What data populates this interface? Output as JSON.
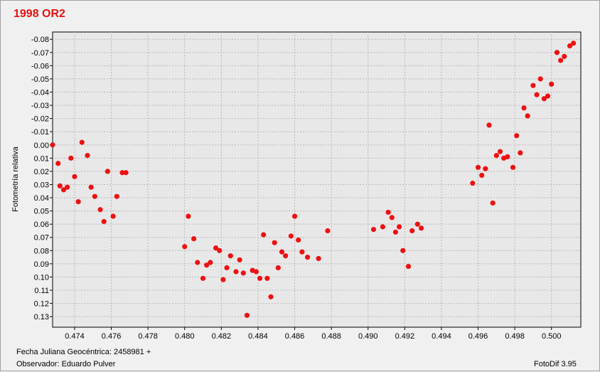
{
  "window": {
    "title": "1998 OR2",
    "title_color": "#e81010",
    "footer_xlabel": "Fecha Juliana Geocéntrica: 2458981 +",
    "footer_observer": "Observador: Eduardo Pulver",
    "footer_app": "FotoDif 3.95"
  },
  "chart_data": {
    "type": "scatter",
    "title": "1998 OR2",
    "xlabel": "Fecha Juliana Geocéntrica: 2458981 +",
    "ylabel": "Fotometría relativa",
    "xlim": [
      0.4728,
      0.5016
    ],
    "ylim": [
      0.138,
      -0.0855
    ],
    "y_inverted": true,
    "grid": true,
    "marker_color": "#ee1111",
    "x_ticks": [
      "0.474",
      "0.476",
      "0.478",
      "0.480",
      "0.482",
      "0.484",
      "0.486",
      "0.488",
      "0.490",
      "0.492",
      "0.494",
      "0.496",
      "0.498",
      "0.500"
    ],
    "x_tick_values": [
      0.474,
      0.476,
      0.478,
      0.48,
      0.482,
      0.484,
      0.486,
      0.488,
      0.49,
      0.492,
      0.494,
      0.496,
      0.498,
      0.5
    ],
    "y_ticks": [
      "-0.08",
      "-0.07",
      "-0.06",
      "-0.05",
      "-0.04",
      "-0.03",
      "-0.02",
      "-0.01",
      "0.00",
      "0.01",
      "0.02",
      "0.03",
      "0.04",
      "0.05",
      "0.06",
      "0.07",
      "0.08",
      "0.09",
      "0.10",
      "0.11",
      "0.12",
      "0.13"
    ],
    "y_tick_values": [
      -0.08,
      -0.07,
      -0.06,
      -0.05,
      -0.04,
      -0.03,
      -0.02,
      -0.01,
      0,
      0.01,
      0.02,
      0.03,
      0.04,
      0.05,
      0.06,
      0.07,
      0.08,
      0.09,
      0.1,
      0.11,
      0.12,
      0.13
    ],
    "points": [
      [
        0.4728,
        0.0
      ],
      [
        0.4731,
        0.014
      ],
      [
        0.4732,
        0.031
      ],
      [
        0.4734,
        0.034
      ],
      [
        0.4736,
        0.032
      ],
      [
        0.4738,
        0.01
      ],
      [
        0.474,
        0.024
      ],
      [
        0.4742,
        0.043
      ],
      [
        0.4744,
        -0.002
      ],
      [
        0.4747,
        0.008
      ],
      [
        0.4749,
        0.032
      ],
      [
        0.4751,
        0.039
      ],
      [
        0.4754,
        0.049
      ],
      [
        0.4756,
        0.058
      ],
      [
        0.4758,
        0.02
      ],
      [
        0.4761,
        0.054
      ],
      [
        0.4763,
        0.039
      ],
      [
        0.4766,
        0.021
      ],
      [
        0.4768,
        0.021
      ],
      [
        0.48,
        0.077
      ],
      [
        0.4802,
        0.054
      ],
      [
        0.4805,
        0.071
      ],
      [
        0.4807,
        0.089
      ],
      [
        0.481,
        0.101
      ],
      [
        0.4812,
        0.091
      ],
      [
        0.4814,
        0.089
      ],
      [
        0.4817,
        0.078
      ],
      [
        0.4819,
        0.08
      ],
      [
        0.4821,
        0.102
      ],
      [
        0.4823,
        0.093
      ],
      [
        0.4825,
        0.084
      ],
      [
        0.4828,
        0.096
      ],
      [
        0.483,
        0.087
      ],
      [
        0.4832,
        0.097
      ],
      [
        0.4834,
        0.129
      ],
      [
        0.4837,
        0.095
      ],
      [
        0.4839,
        0.096
      ],
      [
        0.4841,
        0.101
      ],
      [
        0.4843,
        0.068
      ],
      [
        0.4845,
        0.101
      ],
      [
        0.4847,
        0.115
      ],
      [
        0.4849,
        0.074
      ],
      [
        0.4851,
        0.093
      ],
      [
        0.4853,
        0.081
      ],
      [
        0.4855,
        0.084
      ],
      [
        0.4858,
        0.069
      ],
      [
        0.486,
        0.054
      ],
      [
        0.4862,
        0.072
      ],
      [
        0.4864,
        0.081
      ],
      [
        0.4867,
        0.085
      ],
      [
        0.4873,
        0.086
      ],
      [
        0.4878,
        0.065
      ],
      [
        0.4903,
        0.064
      ],
      [
        0.4908,
        0.062
      ],
      [
        0.4911,
        0.051
      ],
      [
        0.4913,
        0.055
      ],
      [
        0.4915,
        0.066
      ],
      [
        0.4917,
        0.062
      ],
      [
        0.4919,
        0.08
      ],
      [
        0.4922,
        0.092
      ],
      [
        0.4924,
        0.065
      ],
      [
        0.4927,
        0.06
      ],
      [
        0.4929,
        0.063
      ],
      [
        0.4957,
        0.029
      ],
      [
        0.496,
        0.017
      ],
      [
        0.4962,
        0.023
      ],
      [
        0.4964,
        0.018
      ],
      [
        0.4966,
        -0.015
      ],
      [
        0.4968,
        0.044
      ],
      [
        0.497,
        0.008
      ],
      [
        0.4972,
        0.005
      ],
      [
        0.4974,
        0.01
      ],
      [
        0.4976,
        0.009
      ],
      [
        0.4979,
        0.017
      ],
      [
        0.4981,
        -0.007
      ],
      [
        0.4983,
        0.006
      ],
      [
        0.4985,
        -0.028
      ],
      [
        0.4987,
        -0.022
      ],
      [
        0.499,
        -0.045
      ],
      [
        0.4992,
        -0.038
      ],
      [
        0.4994,
        -0.05
      ],
      [
        0.4996,
        -0.035
      ],
      [
        0.4998,
        -0.037
      ],
      [
        0.5,
        -0.046
      ],
      [
        0.5003,
        -0.07
      ],
      [
        0.5005,
        -0.064
      ],
      [
        0.5007,
        -0.067
      ],
      [
        0.501,
        -0.075
      ],
      [
        0.5012,
        -0.077
      ]
    ]
  }
}
